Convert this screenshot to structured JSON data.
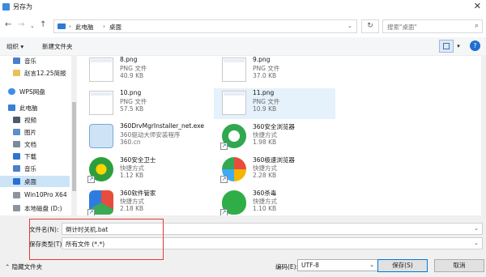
{
  "window": {
    "title": "另存为"
  },
  "nav": {
    "breadcrumb": [
      "此电脑",
      "桌面"
    ],
    "search_placeholder": "搜索\"桌面\""
  },
  "toolbar": {
    "organize": "组织 ▾",
    "new_folder": "新建文件夹"
  },
  "sidebar": {
    "items": [
      {
        "label": "音乐",
        "icon": "music-icon"
      },
      {
        "label": "赵言12.25简报",
        "icon": "folder-icon"
      },
      {
        "label": "WPS网盘",
        "icon": "cloud-icon"
      },
      {
        "label": "此电脑",
        "icon": "computer-icon"
      },
      {
        "label": "视频",
        "icon": "video-icon"
      },
      {
        "label": "图片",
        "icon": "image-icon"
      },
      {
        "label": "文档",
        "icon": "document-icon"
      },
      {
        "label": "下载",
        "icon": "download-icon"
      },
      {
        "label": "音乐",
        "icon": "music-icon"
      },
      {
        "label": "桌面",
        "icon": "desktop-icon"
      },
      {
        "label": "Win10Pro X64",
        "icon": "drive-icon"
      },
      {
        "label": "本地磁盘 (D:)",
        "icon": "drive-icon"
      }
    ]
  },
  "files": [
    {
      "name": "8.png",
      "type": "PNG 文件",
      "size": "40.9 KB",
      "kind": "png"
    },
    {
      "name": "9.png",
      "type": "PNG 文件",
      "size": "37.0 KB",
      "kind": "png"
    },
    {
      "name": "10.png",
      "type": "PNG 文件",
      "size": "57.5 KB",
      "kind": "png"
    },
    {
      "name": "11.png",
      "type": "PNG 文件",
      "size": "10.9 KB",
      "kind": "png"
    },
    {
      "name": "360DrvMgrInstaller_net.exe",
      "type": "360驱动大师安装程序",
      "size": "360.cn",
      "kind": "exe"
    },
    {
      "name": "360安全浏览器",
      "type": "快捷方式",
      "size": "1.98 KB",
      "kind": "browser"
    },
    {
      "name": "360安全卫士",
      "type": "快捷方式",
      "size": "1.12 KB",
      "kind": "guard"
    },
    {
      "name": "360极速浏览器",
      "type": "快捷方式",
      "size": "2.28 KB",
      "kind": "chrome"
    },
    {
      "name": "360软件管家",
      "type": "快捷方式",
      "size": "2.18 KB",
      "kind": "softmgr"
    },
    {
      "name": "360杀毒",
      "type": "快捷方式",
      "size": "1.10 KB",
      "kind": "antivirus"
    }
  ],
  "form": {
    "filename_label": "文件名(N):",
    "filename_value": "倒计时关机.bat",
    "filetype_label": "保存类型(T):",
    "filetype_value": "所有文件 (*.*)",
    "hide_folders": "隐藏文件夹",
    "encoding_label": "编码(E):",
    "encoding_value": "UTF-8",
    "save": "保存(S)",
    "cancel": "取消"
  },
  "colors": {
    "accent": "#0078d7",
    "highlight": "#e53935"
  }
}
